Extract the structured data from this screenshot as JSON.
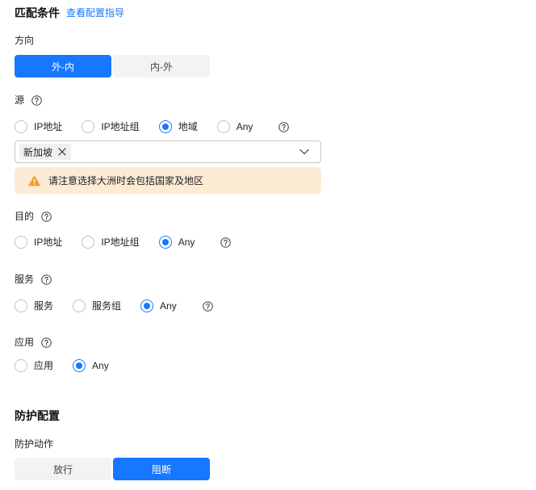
{
  "colors": {
    "accent": "#1677ff",
    "segment_bg": "#f2f3f5",
    "text": "#191919",
    "warning_bg": "#fdebd6",
    "warning_icon": "#f59a23"
  },
  "icons": {
    "help": "help-icon",
    "close": "close-icon",
    "chevron": "chevron-down-icon",
    "warning": "warning-icon"
  },
  "match_conditions": {
    "title": "匹配条件",
    "guide_link": "查看配置指导",
    "direction": {
      "label": "方向",
      "options": [
        {
          "label": "外-内",
          "selected": true
        },
        {
          "label": "内-外",
          "selected": false
        }
      ]
    },
    "source": {
      "label": "源",
      "options": [
        {
          "label": "IP地址",
          "checked": false
        },
        {
          "label": "IP地址组",
          "checked": false
        },
        {
          "label": "地域",
          "checked": true
        },
        {
          "label": "Any",
          "checked": false
        }
      ],
      "region_select": {
        "tags": [
          "新加坡"
        ]
      },
      "warning": "请注意选择大洲时会包括国家及地区"
    },
    "destination": {
      "label": "目的",
      "options": [
        {
          "label": "IP地址",
          "checked": false
        },
        {
          "label": "IP地址组",
          "checked": false
        },
        {
          "label": "Any",
          "checked": true
        }
      ]
    },
    "service": {
      "label": "服务",
      "options": [
        {
          "label": "服务",
          "checked": false
        },
        {
          "label": "服务组",
          "checked": false
        },
        {
          "label": "Any",
          "checked": true
        }
      ]
    },
    "application": {
      "label": "应用",
      "options": [
        {
          "label": "应用",
          "checked": false
        },
        {
          "label": "Any",
          "checked": true
        }
      ]
    }
  },
  "protection": {
    "title": "防护配置",
    "action": {
      "label": "防护动作",
      "options": [
        {
          "label": "放行",
          "selected": false
        },
        {
          "label": "阻断",
          "selected": true
        }
      ]
    }
  }
}
